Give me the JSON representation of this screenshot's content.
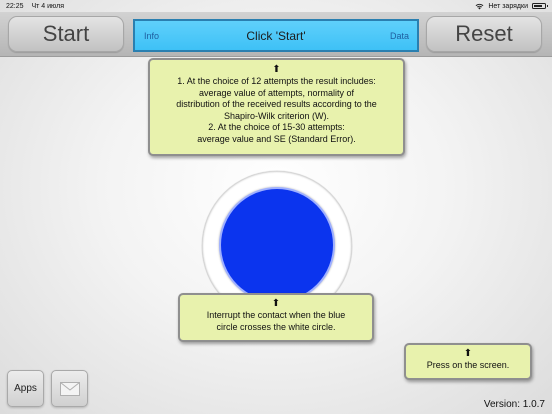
{
  "status_bar": {
    "time": "22:25",
    "date": "Чт 4 июля",
    "charging": "Нет зарядки",
    "battery_level": 0.75
  },
  "toolbar": {
    "start_label": "Start",
    "reset_label": "Reset",
    "display": {
      "info_label": "Info",
      "message": "Click 'Start'",
      "data_label": "Data",
      "background_color": "#3ec1f6"
    }
  },
  "info_callout": {
    "arrow": "⬆",
    "line1": "1. At the choice of 12 attempts the result includes:",
    "line2": "average value of attempts, normality of",
    "line3": "distribution of the received results according to the",
    "line4": "Shapiro-Wilk criterion (W).",
    "line5": "2. At the choice of 15-30 attempts:",
    "line6": "average value and SE (Standard Error)."
  },
  "circle": {
    "blue_color": "#0b34ee",
    "ring_color": "#ffffff"
  },
  "contact_callout": {
    "arrow": "⬆",
    "line1": "Interrupt the contact when the blue",
    "line2": "circle crosses the white circle."
  },
  "press_callout": {
    "arrow": "⬆",
    "text": "Press on the screen."
  },
  "bottom": {
    "apps_label": "Apps",
    "mail_icon": "envelope-icon",
    "version": "Version: 1.0.7"
  },
  "colors": {
    "callout_bg": "#e8f2ad",
    "toolbar_bg": "#c4c4c4"
  }
}
